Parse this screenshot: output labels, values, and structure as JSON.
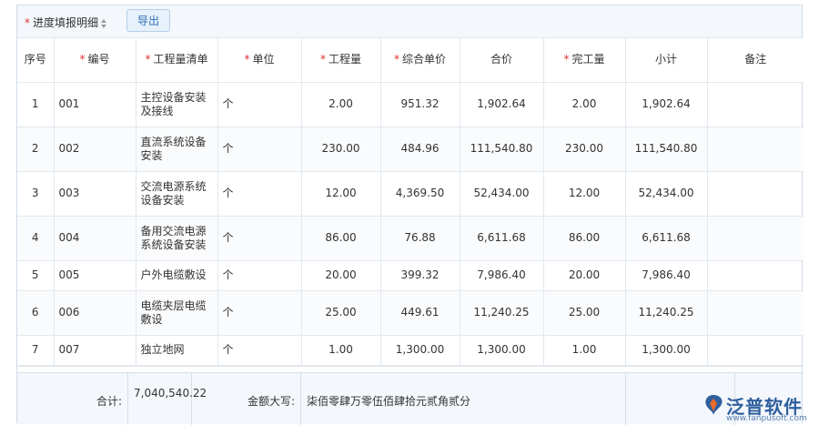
{
  "toolbar": {
    "section_title": "进度填报明细",
    "export_label": "导出"
  },
  "columns": [
    {
      "label": "序号",
      "required": false
    },
    {
      "label": "编号",
      "required": true
    },
    {
      "label": "工程量清单",
      "required": true
    },
    {
      "label": "单位",
      "required": true
    },
    {
      "label": "工程量",
      "required": true
    },
    {
      "label": "综合单价",
      "required": true
    },
    {
      "label": "合价",
      "required": false
    },
    {
      "label": "完工量",
      "required": true
    },
    {
      "label": "小计",
      "required": false
    },
    {
      "label": "备注",
      "required": false
    }
  ],
  "rows": [
    {
      "seq": "1",
      "code": "001",
      "item": "主控设备安装及接线",
      "unit": "个",
      "qty": "2.00",
      "unit_price": "951.32",
      "total": "1,902.64",
      "done": "2.00",
      "subtotal": "1,902.64",
      "note": ""
    },
    {
      "seq": "2",
      "code": "002",
      "item": "直流系统设备安装",
      "unit": "个",
      "qty": "230.00",
      "unit_price": "484.96",
      "total": "111,540.80",
      "done": "230.00",
      "subtotal": "111,540.80",
      "note": ""
    },
    {
      "seq": "3",
      "code": "003",
      "item": "交流电源系统设备安装",
      "unit": "个",
      "qty": "12.00",
      "unit_price": "4,369.50",
      "total": "52,434.00",
      "done": "12.00",
      "subtotal": "52,434.00",
      "note": ""
    },
    {
      "seq": "4",
      "code": "004",
      "item": "备用交流电源系统设备安装",
      "unit": "个",
      "qty": "86.00",
      "unit_price": "76.88",
      "total": "6,611.68",
      "done": "86.00",
      "subtotal": "6,611.68",
      "note": ""
    },
    {
      "seq": "5",
      "code": "005",
      "item": "户外电缆敷设",
      "unit": "个",
      "qty": "20.00",
      "unit_price": "399.32",
      "total": "7,986.40",
      "done": "20.00",
      "subtotal": "7,986.40",
      "note": ""
    },
    {
      "seq": "6",
      "code": "006",
      "item": "电缆夹层电缆敷设",
      "unit": "个",
      "qty": "25.00",
      "unit_price": "449.61",
      "total": "11,240.25",
      "done": "25.00",
      "subtotal": "11,240.25",
      "note": ""
    },
    {
      "seq": "7",
      "code": "007",
      "item": "独立地网",
      "unit": "个",
      "qty": "1.00",
      "unit_price": "1,300.00",
      "total": "1,300.00",
      "done": "1.00",
      "subtotal": "1,300.00",
      "note": ""
    }
  ],
  "footer": {
    "total_label": "合计:",
    "total_value": "7,040,540.22",
    "amount_label": "金额大写:",
    "amount_value": "柒佰零肆万零伍佰肆拾元贰角贰分"
  },
  "logo": {
    "text": "泛普软件",
    "url": "www.fanpusoft.com"
  },
  "colors": {
    "required_mark": "#e02d2d",
    "accent": "#2a6fb5",
    "header_bg": "#f4f7fb",
    "border": "#e3e8ee"
  }
}
